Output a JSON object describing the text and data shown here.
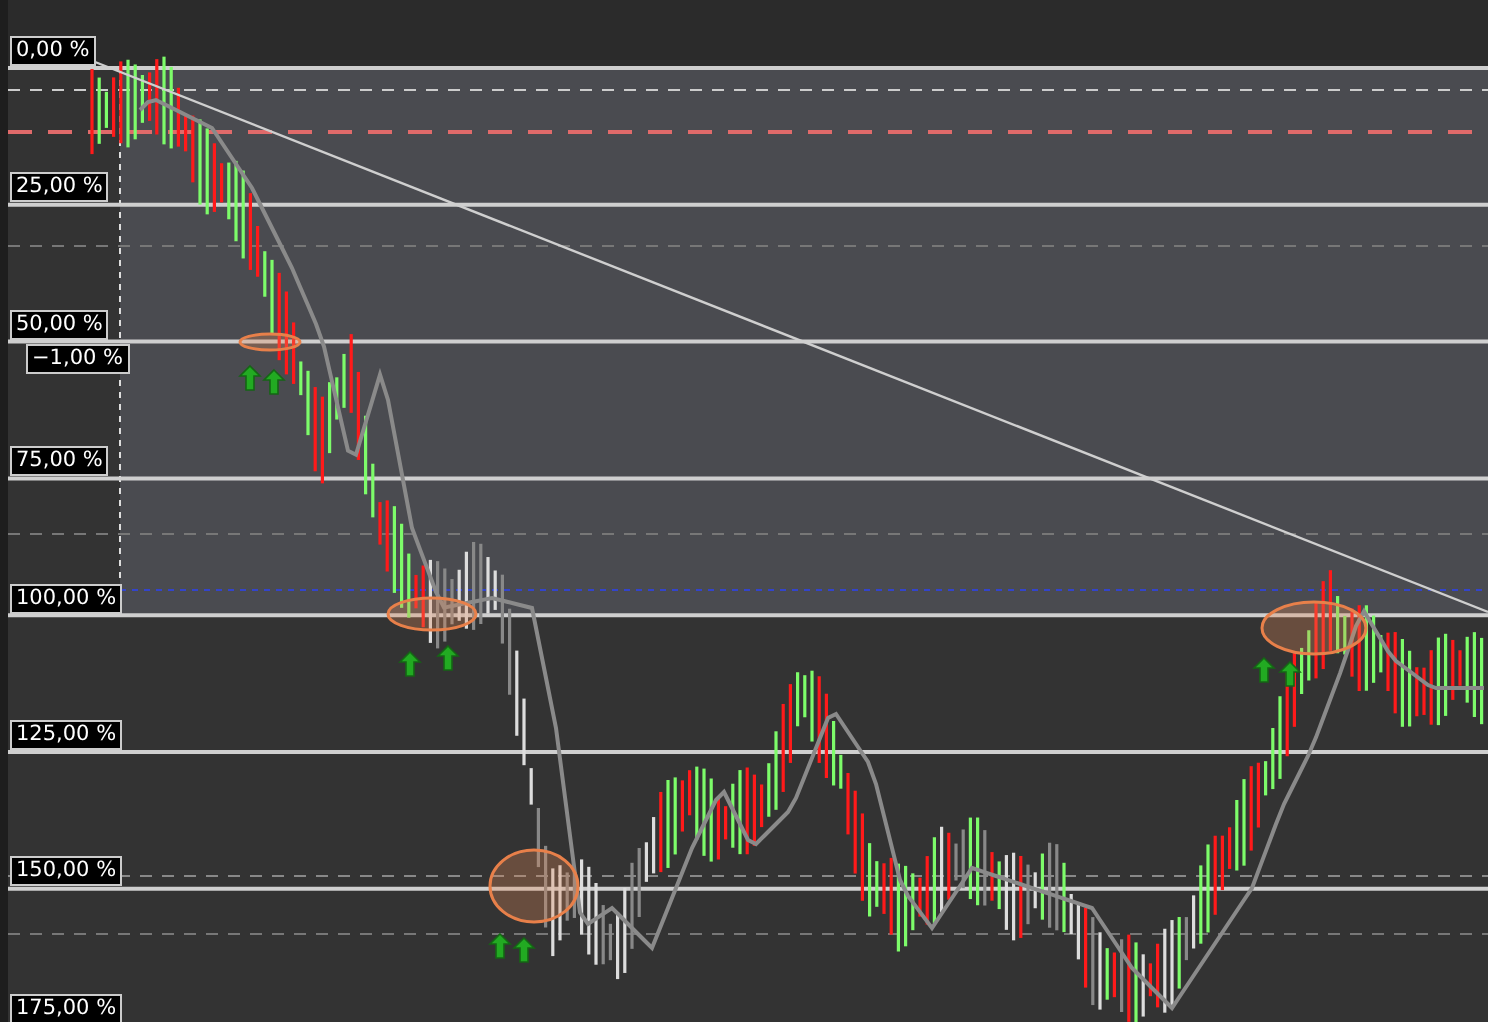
{
  "levels": [
    {
      "label": "0,00 %"
    },
    {
      "label": "25,00 %"
    },
    {
      "label": "50,00 %"
    },
    {
      "label": "75,00 %"
    },
    {
      "label": "100,00 %"
    },
    {
      "label": "125,00 %"
    },
    {
      "label": "150,00 %"
    },
    {
      "label": "175,00 %"
    }
  ],
  "marker_label": "−1,00 %"
}
